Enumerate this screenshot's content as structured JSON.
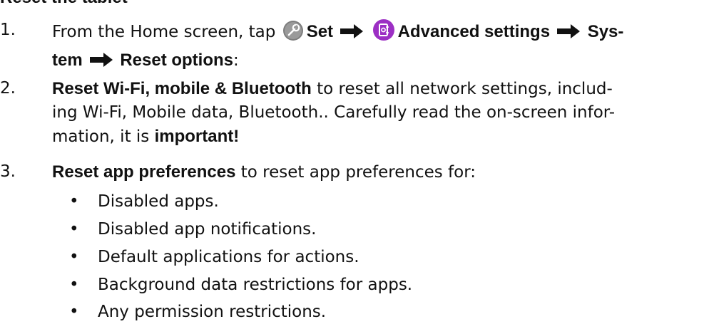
{
  "heading": "Reset the tablet",
  "steps": [
    {
      "number": "1.",
      "lines": [
        {
          "prefix": "From the Home screen, tap",
          "icon1": "wrench-icon",
          "set": "Set",
          "icon2": "device-settings-icon",
          "advanced": "Advanced settings",
          "sys": "Sys-"
        },
        {
          "tem": "tem",
          "reset_options": "Reset options",
          "colon": ":"
        }
      ]
    },
    {
      "number": "2.",
      "title": "Reset Wi-Fi, mobile & Bluetooth",
      "rest1": " to reset all network settings, includ-",
      "line2": "ing Wi-Fi, Mobile data, Bluetooth.. Carefully read the on-screen infor-",
      "line3_prefix": "mation, it is ",
      "important": "important!"
    },
    {
      "number": "3.",
      "title": "Reset app preferences",
      "rest": " to reset app preferences for:"
    }
  ],
  "bullet_symbol": "•",
  "bullets": [
    "Disabled apps.",
    "Disabled app notifications.",
    "Default applications for actions.",
    "Background data restrictions for apps.",
    "Any permission restrictions."
  ],
  "colors": {
    "wrench_icon_bg": "#8a8a8a",
    "device_settings_icon_bg": "#9c2fc4",
    "text": "#111111"
  }
}
